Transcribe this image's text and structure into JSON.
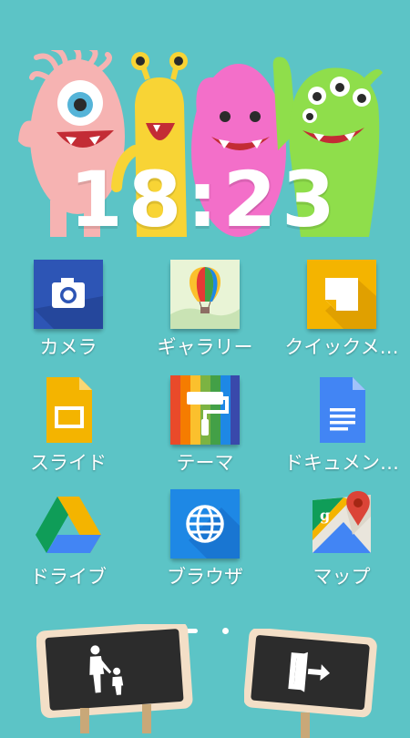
{
  "status": {
    "clock": "18:23"
  },
  "apps": [
    {
      "label": "カメラ",
      "icon": "camera-icon",
      "color": "#2d55b5"
    },
    {
      "label": "ギャラリー",
      "icon": "gallery-balloon-icon",
      "color": "#e9f4d6"
    },
    {
      "label": "クイックメ…",
      "icon": "quick-memo-icon",
      "color": "#f4b400"
    },
    {
      "label": "スライド",
      "icon": "slides-icon",
      "color": "#f4b400"
    },
    {
      "label": "テーマ",
      "icon": "theme-roller-icon",
      "color": "#e94a2a"
    },
    {
      "label": "ドキュメン…",
      "icon": "docs-icon",
      "color": "#4285f4"
    },
    {
      "label": "ドライブ",
      "icon": "drive-icon",
      "color": "#0f9d58"
    },
    {
      "label": "ブラウザ",
      "icon": "browser-globe-icon",
      "color": "#1e88e5"
    },
    {
      "label": "マップ",
      "icon": "maps-icon",
      "color": "#e9e5dc"
    }
  ],
  "pager": {
    "pages": 2,
    "current": 1
  },
  "signs": {
    "left": {
      "icon": "parent-child-icon"
    },
    "right": {
      "icon": "exit-door-icon"
    }
  }
}
